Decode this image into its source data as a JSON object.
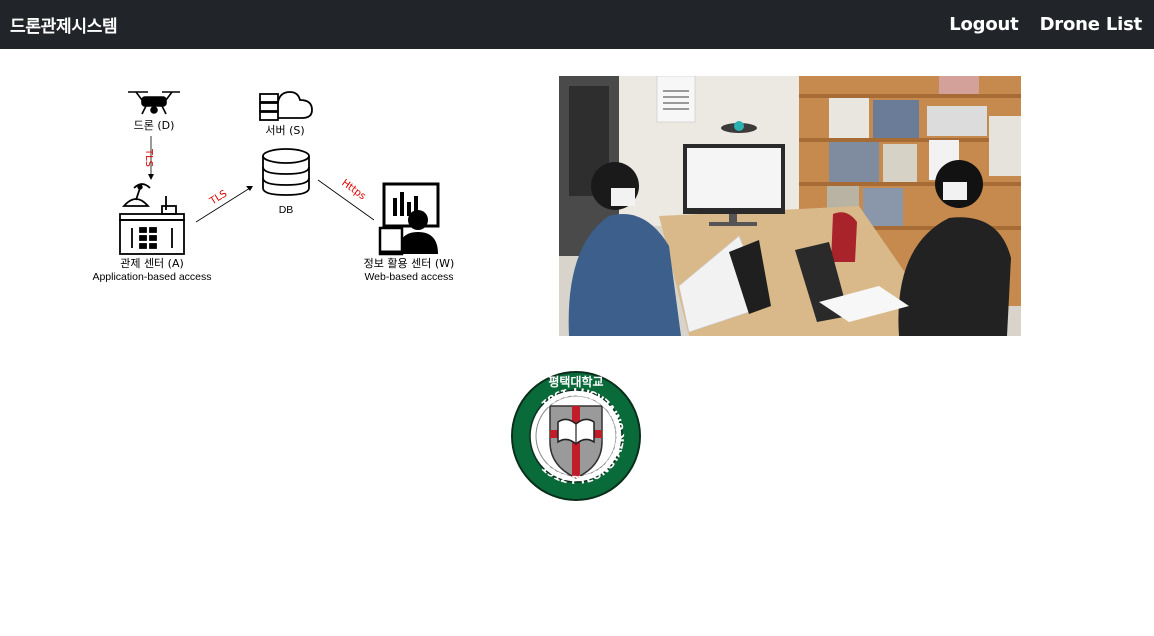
{
  "navbar": {
    "brand": "드론관제시스템",
    "links": [
      {
        "label": "Logout"
      },
      {
        "label": "Drone List"
      }
    ]
  },
  "diagram": {
    "drone_label": "드론 (D)",
    "server_label": "서버 (S)",
    "db_label": "DB",
    "control_label": "관제 센터 (A)",
    "control_sub": "Application-based access",
    "web_label": "정보 활용 센터 (W)",
    "web_sub": "Web-based access",
    "edge_tls_vertical": "TLS",
    "edge_tls_diag": "TLS",
    "edge_https": "Https",
    "edge_color": "#e00000"
  },
  "logo": {
    "top_text": "평택대학교",
    "ring_text": "1912 PYEONGTAEK UNIVERSITY 1981",
    "ring_color": "#0a6b3a"
  }
}
